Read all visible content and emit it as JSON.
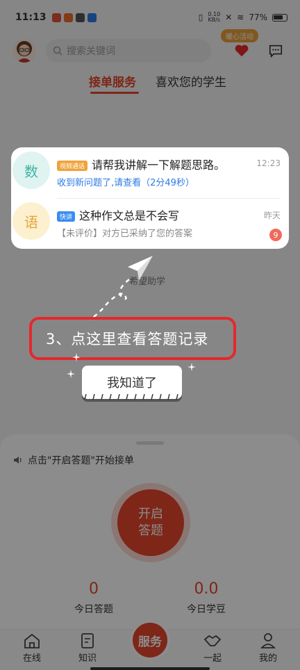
{
  "status_bar": {
    "time": "11:13",
    "net_speed_value": "0.10",
    "net_speed_unit": "KB/s",
    "battery": "77%"
  },
  "header": {
    "search_placeholder": "搜索关键词",
    "activity_badge": "暖心活动"
  },
  "tabs": [
    {
      "label": "接单服务",
      "active": true
    },
    {
      "label": "喜欢您的学生",
      "active": false
    }
  ],
  "messages": [
    {
      "subject": "数",
      "tag": "视频通话",
      "title": "请帮我讲解一下解题思路。",
      "subtitle": "收到新问题了,请查看（2分49秒）",
      "time": "12:23"
    },
    {
      "subject": "语",
      "tag": "快讲",
      "title": "这种作文总是不会写",
      "subtitle": "【未评价】对方已采纳了您的答案",
      "time": "昨天",
      "unread": "9"
    }
  ],
  "background_hint": "希望助学",
  "guide": {
    "step_text": "3、点这里查看答题记录",
    "got_it": "我知道了"
  },
  "panel": {
    "hint": "点击\"开启答题\"开始接单",
    "start_line1": "开启",
    "start_line2": "答题",
    "stats": [
      {
        "value": "0",
        "label": "今日答题"
      },
      {
        "value": "0.0",
        "label": "今日学豆"
      }
    ]
  },
  "nav": {
    "items": [
      "在线",
      "知识",
      "服务",
      "一起",
      "我的"
    ]
  },
  "colors": {
    "accent": "#e5452c",
    "math": "#3fb3a3",
    "chinese": "#e2a63b",
    "guide_border": "#e5282c"
  }
}
